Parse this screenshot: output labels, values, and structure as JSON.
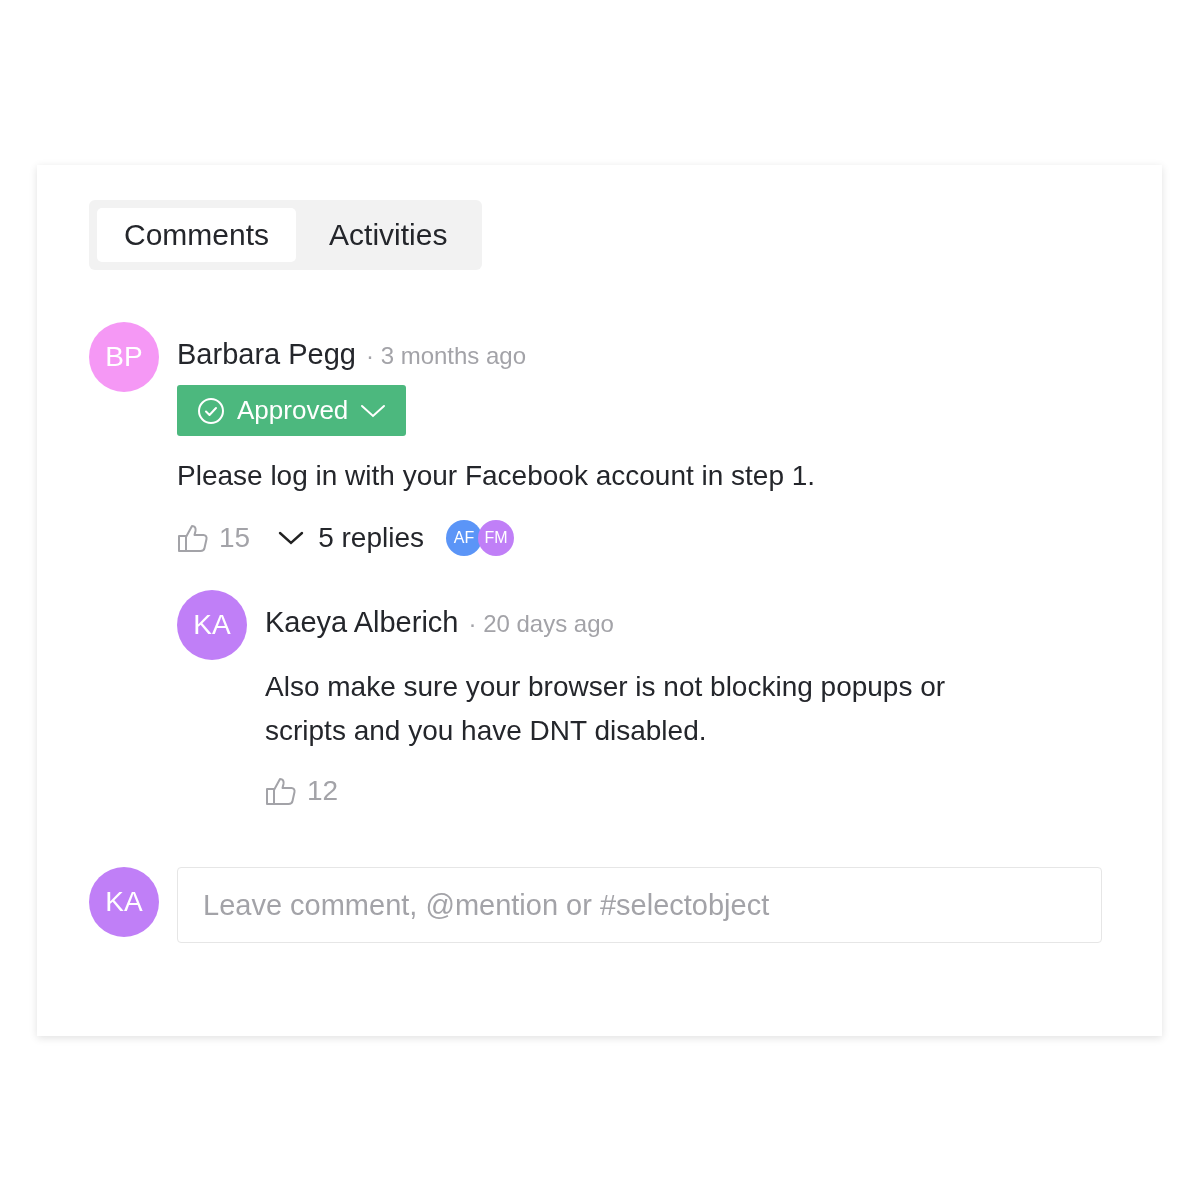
{
  "tabs": [
    {
      "label": "Comments",
      "selected": true
    },
    {
      "label": "Activities",
      "selected": false
    }
  ],
  "comments": [
    {
      "avatar": {
        "initials": "BP",
        "color": "#f598f5"
      },
      "author": "Barbara Pegg",
      "time": "· 3 months ago",
      "status": "Approved",
      "text": "Please log in with your Facebook account in step 1.",
      "likes": "15",
      "replies": {
        "label": "5 replies",
        "expanded": true,
        "avatars": [
          {
            "initials": "AF",
            "color": "#5b95f7"
          },
          {
            "initials": "FM",
            "color": "#c07ff7"
          }
        ]
      },
      "children": [
        {
          "avatar": {
            "initials": "KA",
            "color": "#c07ff7"
          },
          "author": "Kaeya Alberich",
          "time": "· 20 days ago",
          "text": "Also make sure your browser is not blocking popups or scripts and you have DNT disabled.",
          "likes": "12"
        }
      ]
    }
  ],
  "composer": {
    "avatar": {
      "initials": "KA",
      "color": "#c07ff7"
    },
    "placeholder": "Leave comment, @mention or #selectobject"
  }
}
